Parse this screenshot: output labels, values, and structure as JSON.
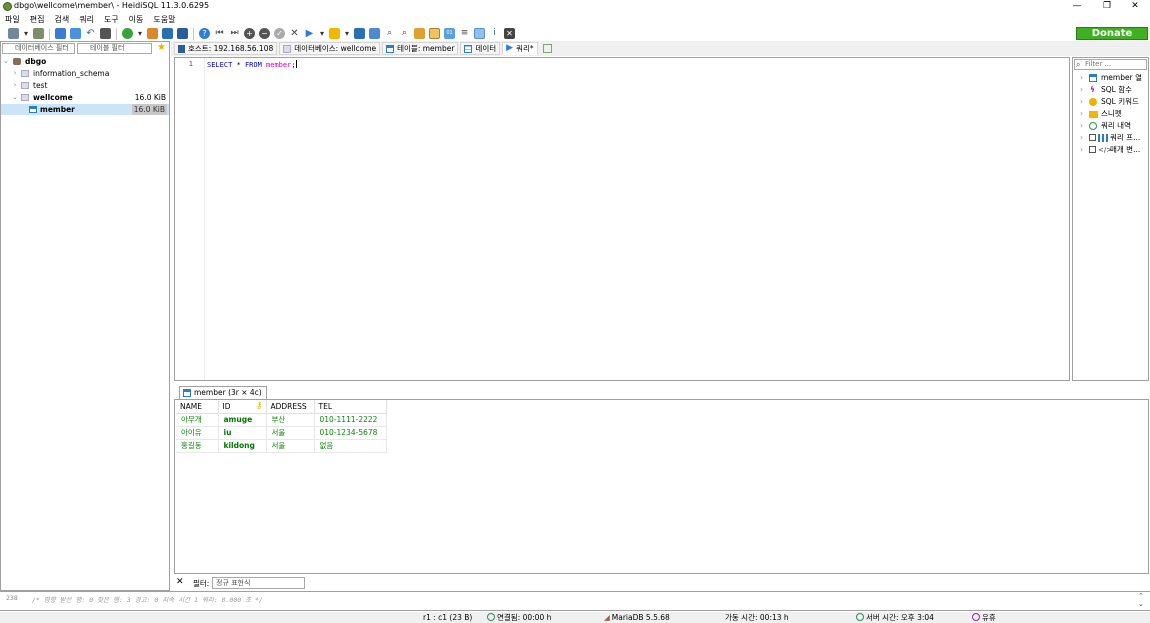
{
  "window": {
    "title": "dbgo\\wellcome\\member\\ - HeidiSQL 11.3.0.6295",
    "minimize": "—",
    "restore": "❐",
    "close": "✕"
  },
  "menu": [
    "파일",
    "편집",
    "검색",
    "쿼리",
    "도구",
    "이동",
    "도움말"
  ],
  "toolbar": {
    "donate_label": "Donate"
  },
  "left_panel": {
    "db_filter_placeholder": "데이터베이스 필터",
    "table_filter_placeholder": "테이블 필터",
    "tree": [
      {
        "label": "dbgo",
        "size": ""
      },
      {
        "label": "information_schema",
        "size": ""
      },
      {
        "label": "test",
        "size": ""
      },
      {
        "label": "wellcome",
        "size": "16.0 KiB"
      },
      {
        "label": "member",
        "size": "16.0 KiB"
      }
    ]
  },
  "tabs": [
    {
      "label": "호스트: 192.168.56.108"
    },
    {
      "label": "데이터베이스: wellcome"
    },
    {
      "label": "테이블: member"
    },
    {
      "label": "데이터"
    },
    {
      "label": "쿼리*"
    }
  ],
  "editor": {
    "line_number": "1",
    "sql_select": "SELECT",
    "sql_star": " * ",
    "sql_from": "FROM",
    "sql_space": " ",
    "sql_table": "member",
    "sql_end": ";"
  },
  "helper": {
    "filter_placeholder": "Filter ...",
    "items": [
      {
        "label": "member 열"
      },
      {
        "label": "SQL 함수"
      },
      {
        "label": "SQL 키워드"
      },
      {
        "label": "스니펫"
      },
      {
        "label": "쿼리 내역"
      },
      {
        "label": "쿼리 프..."
      },
      {
        "label": "매개 변..."
      }
    ]
  },
  "result": {
    "tab_label": "member (3r × 4c)",
    "columns": [
      "NAME",
      "ID",
      "ADDRESS",
      "TEL"
    ],
    "rows": [
      [
        "아무개",
        "amuge",
        "부산",
        "010-1111-2222"
      ],
      [
        "아이유",
        "iu",
        "서울",
        "010-1234-5678"
      ],
      [
        "홍길동",
        "kildong",
        "서울",
        "없음"
      ]
    ]
  },
  "filter": {
    "close": "✕",
    "label": "필터:",
    "placeholder": "정규 표현식"
  },
  "log": {
    "line_number": "238",
    "text": "/* 영향 받은 행: 0  찾은 행: 3  경고: 0  지속 시간 1 쿼리: 0.000 초 */"
  },
  "status": {
    "position": "r1 : c1 (23 B)",
    "connected": "연결됨: 00:00 h",
    "server_version": "MariaDB 5.5.68",
    "uptime": "가동 시간: 00:13 h",
    "server_time": "서버 시간: 오후 3:04",
    "idle": "유휴"
  }
}
